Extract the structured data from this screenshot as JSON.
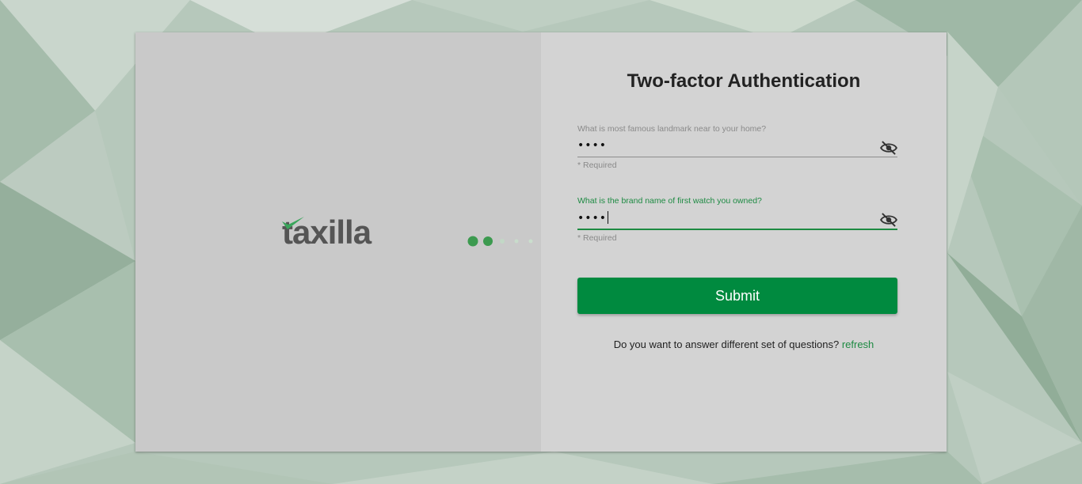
{
  "brand": {
    "logo_text": "taxilla"
  },
  "form": {
    "title": "Two-factor Authentication",
    "question1": {
      "label": "What is most famous landmark near to your home?",
      "value": "••••",
      "hint": "* Required"
    },
    "question2": {
      "label": "What is the brand name of first watch you owned?",
      "value": "••••",
      "hint": "* Required"
    },
    "submit_label": "Submit",
    "footer_text": "Do you want to answer different set of questions?",
    "refresh_label": "refresh"
  },
  "colors": {
    "accent": "#008a3f",
    "link": "#1d8a42",
    "left_panel": "#c9c9c9",
    "right_panel": "#d3d3d3"
  },
  "icons": {
    "visibility_toggle": "eye-off-icon",
    "logo_check": "check-icon"
  }
}
